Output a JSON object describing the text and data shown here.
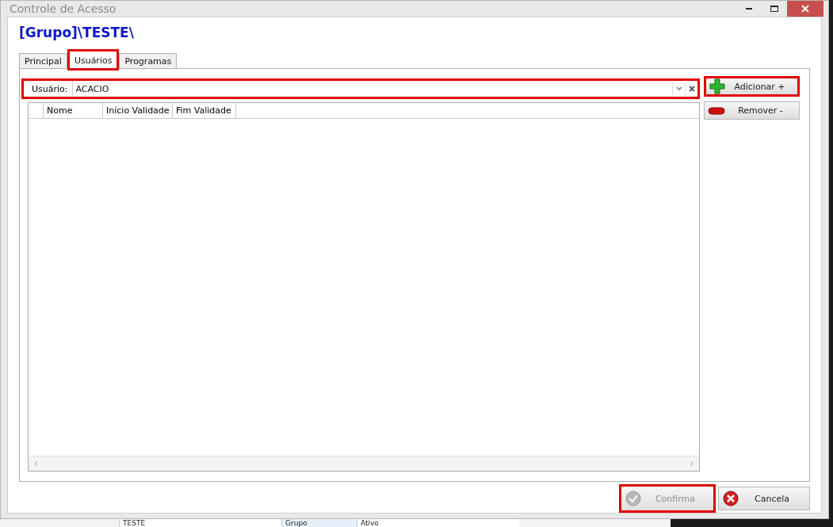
{
  "window": {
    "title": "Controle de Acesso"
  },
  "heading": "[Grupo]\\TESTE\\",
  "tabs": [
    {
      "label": "Principal",
      "selected": false,
      "highlighted": false
    },
    {
      "label": "Usuários",
      "selected": true,
      "highlighted": true
    },
    {
      "label": "Programas",
      "selected": false,
      "highlighted": false
    }
  ],
  "user_field": {
    "label": "Usuário:",
    "value": "ACACIO",
    "highlighted": true
  },
  "side_buttons": [
    {
      "label": "Adicionar +",
      "kind": "add",
      "highlighted": true
    },
    {
      "label": "Remover -",
      "kind": "remove",
      "highlighted": false
    }
  ],
  "table": {
    "columns": [
      "Nome",
      "Início Validade",
      "Fim Validade"
    ]
  },
  "footer_buttons": [
    {
      "label": "Confirma",
      "kind": "confirm",
      "disabled": true,
      "highlighted": true
    },
    {
      "label": "Cancela",
      "kind": "cancel",
      "disabled": false,
      "highlighted": false
    }
  ],
  "background_row": [
    "TESTE",
    "Grupo",
    "Ativo"
  ]
}
